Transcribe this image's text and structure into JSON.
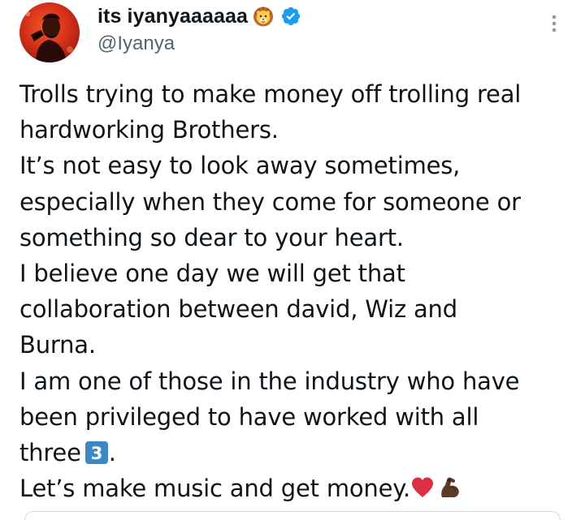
{
  "tweet": {
    "display_name": "its iyanyaaaaaa",
    "handle": "@Iyanya",
    "lines": [
      "Trolls trying to make money off trolling real",
      "hardworking Brothers.",
      "It’s not easy to look away sometimes,",
      "especially when they come for someone or",
      "something so dear to your heart.",
      "I believe one day we will get that",
      "collaboration between david, Wiz and",
      "Burna.",
      "I am one of those in the industry who have",
      "been privileged to have worked with all"
    ],
    "line_three_prefix": "three",
    "line_three_suffix": ".",
    "last_line": "Let’s make music and get money.",
    "icons": {
      "name_emoji": "lion-face-icon",
      "verified": "verified-badge-icon",
      "more": "more-options-icon",
      "keycap": "keycap-3-emoji-icon",
      "heart": "red-heart-emoji-icon",
      "arm": "flexed-biceps-emoji-icon"
    },
    "colors": {
      "text": "#0f1419",
      "secondary": "#536471",
      "verified_blue": "#1d9bf0",
      "keycap_blue": "#3b88c3",
      "heart_red": "#dd2e44"
    }
  }
}
